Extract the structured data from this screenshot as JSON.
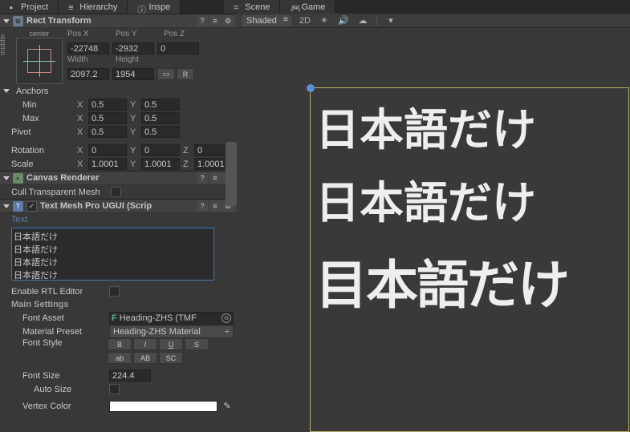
{
  "tabs_left": {
    "project": "Project",
    "hierarchy": "Hierarchy",
    "inspector": "Inspe"
  },
  "tabs_right": {
    "scene": "Scene",
    "game": "Game"
  },
  "scene_toolbar": {
    "shaded": "Shaded",
    "mode2d": "2D"
  },
  "rect_transform": {
    "title": "Rect Transform",
    "anchor_mode": "center",
    "side_label": "middle",
    "headers": {
      "posx": "Pos X",
      "posy": "Pos Y",
      "posz": "Pos Z",
      "width": "Width",
      "height": "Height"
    },
    "posx": "-22748",
    "posy": "-2932",
    "posz": "0",
    "width": "2097.2",
    "height": "1954",
    "blueprint": "",
    "raw": "R",
    "anchors": "Anchors",
    "min": "Min",
    "max": "Max",
    "pivot": "Pivot",
    "min_x": "0.5",
    "min_y": "0.5",
    "max_x": "0.5",
    "max_y": "0.5",
    "pivot_x": "0.5",
    "pivot_y": "0.5",
    "rotation": "Rotation",
    "rot_x": "0",
    "rot_y": "0",
    "rot_z": "0",
    "scale": "Scale",
    "scale_x": "1.0001",
    "scale_y": "1.0001",
    "scale_z": "1.0001"
  },
  "canvas_renderer": {
    "title": "Canvas Renderer",
    "cull": "Cull Transparent Mesh"
  },
  "tmp": {
    "title": "Text Mesh Pro UGUI (Scrip",
    "text_label": "Text",
    "text_value": "日本語だけ\n日本語だけ\n日本語だけ\n日本語だけ",
    "rtl": "Enable RTL Editor",
    "main": "Main Settings",
    "font_asset": "Font Asset",
    "font_asset_val": "Heading-ZHS (TMF",
    "material": "Material Preset",
    "material_val": "Heading-ZHS Material",
    "font_style": "Font Style",
    "styles": {
      "b": "B",
      "i": "I",
      "u": "U",
      "s": "S",
      "ab": "ab",
      "AB": "AB",
      "sc": "SC"
    },
    "font_size": "Font Size",
    "font_size_val": "224.4",
    "auto_size": "Auto Size",
    "vertex_color": "Vertex Color"
  },
  "viewport": {
    "line1": "日本語だけ",
    "line2": "日本語だけ",
    "line3": "目本語だけ"
  },
  "axis": {
    "x": "X",
    "y": "Y",
    "z": "Z"
  }
}
